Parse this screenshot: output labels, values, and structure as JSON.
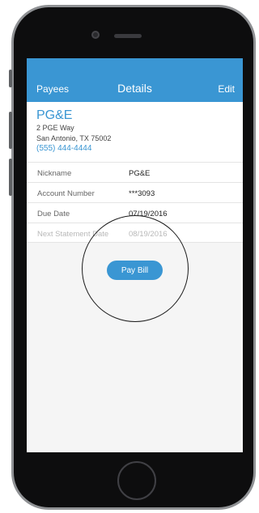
{
  "navbar": {
    "back_label": "Payees",
    "title": "Details",
    "edit_label": "Edit"
  },
  "payee": {
    "name": "PG&E",
    "address_line1": "2 PGE Way",
    "address_line2": "San Antonio, TX 75002",
    "phone": "(555) 444-4444"
  },
  "details": [
    {
      "label": "Nickname",
      "value": "PG&E"
    },
    {
      "label": "Account Number",
      "value": "***3093"
    },
    {
      "label": "Due Date",
      "value": "07/19/2016"
    },
    {
      "label": "Next Statement Date",
      "value": "08/19/2016"
    }
  ],
  "actions": {
    "pay_bill_label": "Pay Bill"
  },
  "colors": {
    "accent": "#3a96d3",
    "screen_background": "#f5f5f5",
    "device_body": "#0d0d0e"
  }
}
